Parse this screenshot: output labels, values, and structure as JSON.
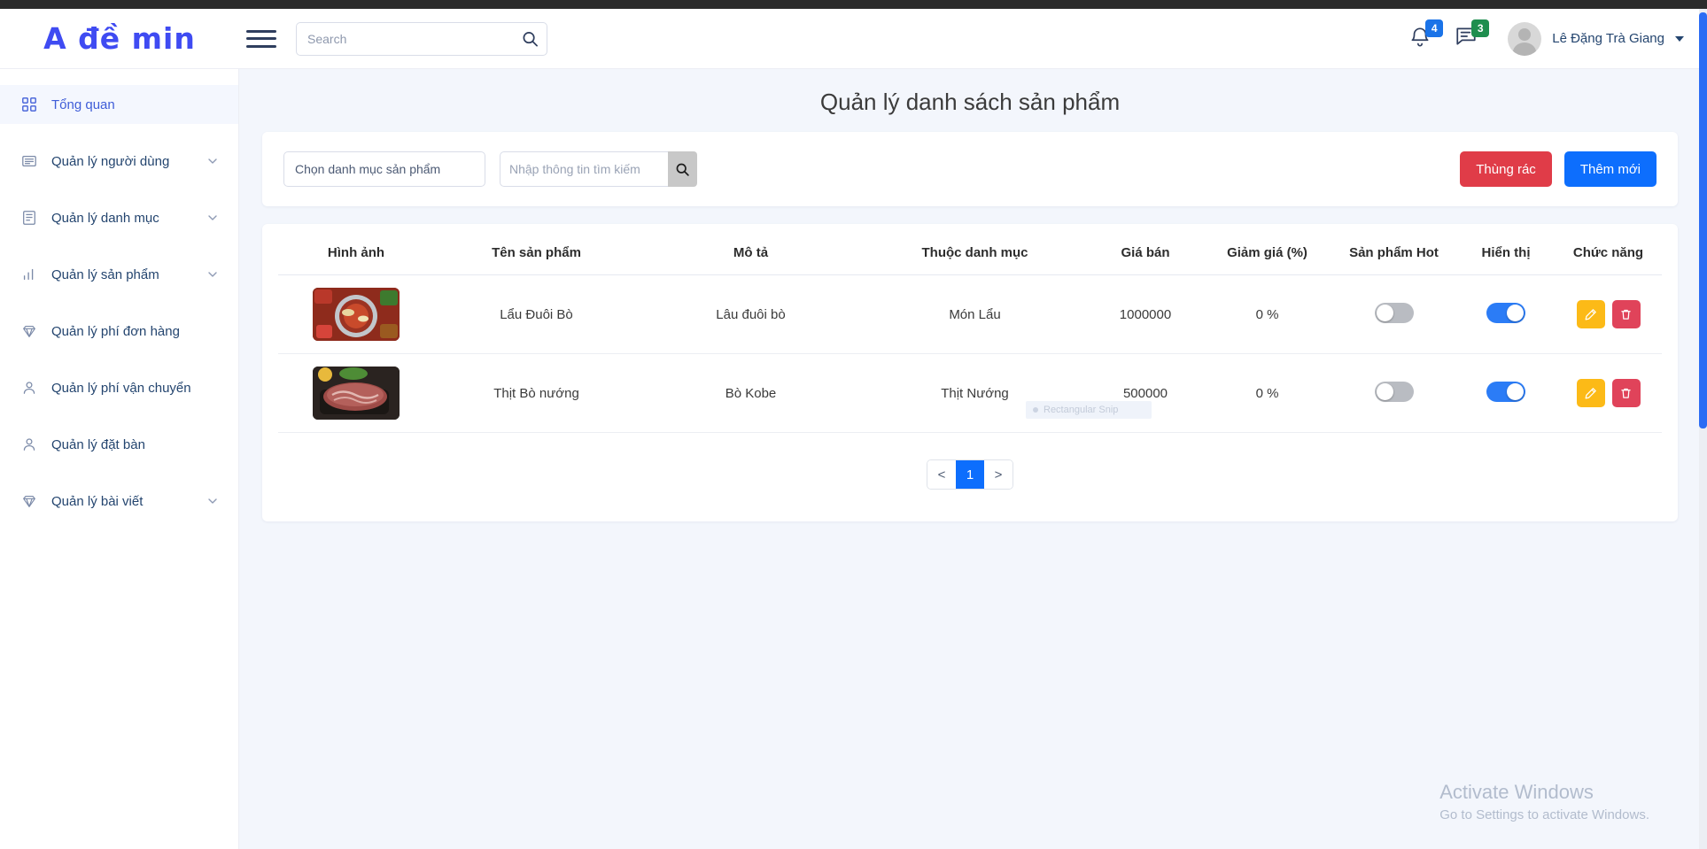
{
  "brand": {
    "text": "A đề min"
  },
  "navbar": {
    "search_placeholder": "Search",
    "search_value": "",
    "search_icon": "magnifier-icon",
    "menu_icon": "hamburger-icon",
    "notification_icon": "bell-icon",
    "notification_count": "4",
    "message_icon": "chat-icon",
    "message_count": "3",
    "user_name": "Lê Đặng Trà Giang",
    "badge_blue": "#1a73e8",
    "badge_green": "#1e8e4e"
  },
  "sidebar": {
    "items": [
      {
        "label": "Tổng quan",
        "icon": "grid-icon",
        "active": true,
        "expandable": false
      },
      {
        "label": "Quản lý người dùng",
        "icon": "id-card-icon",
        "active": false,
        "expandable": true
      },
      {
        "label": "Quản lý danh mục",
        "icon": "list-document-icon",
        "active": false,
        "expandable": true
      },
      {
        "label": "Quản lý sản phẩm",
        "icon": "bar-chart-icon",
        "active": false,
        "expandable": true
      },
      {
        "label": "Quản lý phí đơn hàng",
        "icon": "diamond-icon",
        "active": false,
        "expandable": false
      },
      {
        "label": "Quản lý phí vận chuyển",
        "icon": "user-icon",
        "active": false,
        "expandable": false
      },
      {
        "label": "Quản lý đặt bàn",
        "icon": "user-icon",
        "active": false,
        "expandable": false
      },
      {
        "label": "Quản lý bài viết",
        "icon": "diamond-icon",
        "active": false,
        "expandable": true
      }
    ]
  },
  "main": {
    "page_title": "Quản lý danh sách sản phẩm",
    "filter": {
      "category_select_placeholder": "Chọn danh mục sản phẩm",
      "category_select_value": "Chọn danh mục sản phẩm",
      "search_placeholder": "Nhập thông tin tìm kiếm",
      "search_value": "",
      "search_button_icon": "magnifier-icon",
      "trash_button": "Thùng rác",
      "add_button": "Thêm mới",
      "trash_color": "#e03c48",
      "add_color": "#0d6efd"
    },
    "table": {
      "columns": [
        "Hình ảnh",
        "Tên sản phẩm",
        "Mô tả",
        "Thuộc danh mục",
        "Giá bán",
        "Giảm giá (%)",
        "Sản phẩm Hot",
        "Hiển thị",
        "Chức năng"
      ],
      "rows": [
        {
          "image_alt": "hotpot-photo",
          "name": "Lẩu Đuôi Bò",
          "description": "Lâu đuôi bò",
          "category": "Món Lẩu",
          "price": "1000000",
          "discount": "0 %",
          "hot": false,
          "visible": true,
          "edit_icon": "pen-icon",
          "delete_icon": "trash-icon"
        },
        {
          "image_alt": "grilled-beef-photo",
          "name": "Thịt Bò nướng",
          "description": "Bò Kobe",
          "category": "Thịt Nướng",
          "price": "500000",
          "discount": "0 %",
          "hot": false,
          "visible": true,
          "edit_icon": "pen-icon",
          "delete_icon": "trash-icon"
        }
      ]
    },
    "pagination": {
      "prev": "<",
      "pages": [
        "1"
      ],
      "next": ">",
      "current": "1",
      "active_color": "#0d6efd"
    }
  },
  "overlay": {
    "snip_tooltip": "Rectangular Snip"
  },
  "watermark": {
    "line1": "Activate Windows",
    "line2": "Go to Settings to activate Windows."
  }
}
